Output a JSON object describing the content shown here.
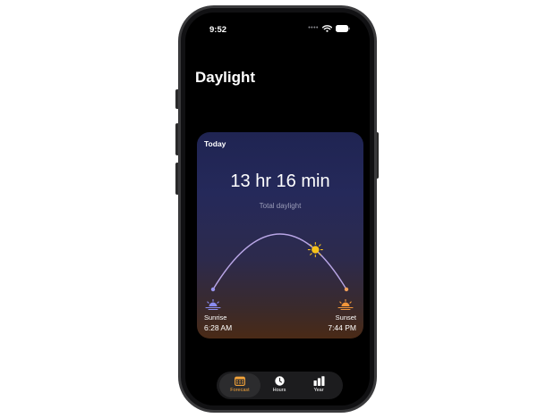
{
  "status_bar": {
    "time": "9:52",
    "signal": "••••"
  },
  "page": {
    "title": "Daylight"
  },
  "card": {
    "label": "Today",
    "total_daylight": "13 hr 16 min",
    "total_daylight_caption": "Total daylight",
    "sunrise_label": "Sunrise",
    "sunrise_time": "6:28 AM",
    "sunset_label": "Sunset",
    "sunset_time": "7:44 PM",
    "sun_progress": 0.72
  },
  "tabs": [
    {
      "label": "Forecast",
      "icon": "calendar-icon",
      "selected": true
    },
    {
      "label": "Hours",
      "icon": "clock-icon",
      "selected": false
    },
    {
      "label": "Year",
      "icon": "bar-chart-icon",
      "selected": false
    }
  ],
  "colors": {
    "accent": "#f2a33a",
    "sun": "#f7c21a",
    "sunrise_icon": "#8a8cf0",
    "sunset_icon": "#f2963a"
  }
}
